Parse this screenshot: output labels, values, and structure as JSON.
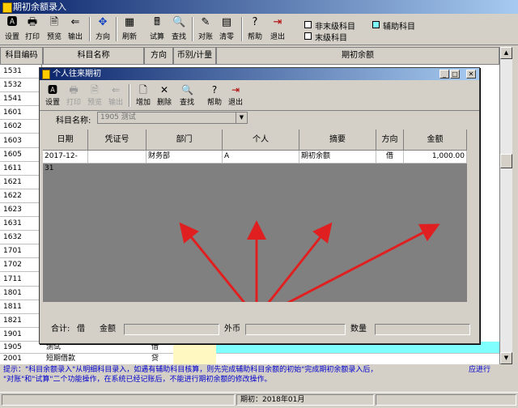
{
  "window": {
    "title": "期初余额录入"
  },
  "toolbar": {
    "buttons": [
      {
        "label": "设置",
        "icon": "settings-icon",
        "glyph": "🅰"
      },
      {
        "label": "打印",
        "icon": "print-icon",
        "glyph": "🖶"
      },
      {
        "label": "预览",
        "icon": "preview-icon",
        "glyph": "🗎"
      },
      {
        "label": "输出",
        "icon": "export-icon",
        "glyph": "⇐"
      },
      {
        "label": "方向",
        "icon": "direction-icon",
        "glyph": "✥"
      },
      {
        "label": "刷新",
        "icon": "refresh-icon",
        "glyph": "▦"
      },
      {
        "label": "试算",
        "icon": "trial-balance-icon",
        "glyph": "🖩"
      },
      {
        "label": "查找",
        "icon": "find-icon",
        "glyph": "🔍"
      },
      {
        "label": "对账",
        "icon": "reconcile-icon",
        "glyph": "✎"
      },
      {
        "label": "清零",
        "icon": "clear-icon",
        "glyph": "▤"
      },
      {
        "label": "帮助",
        "icon": "help-icon",
        "glyph": "?"
      },
      {
        "label": "退出",
        "icon": "exit-icon",
        "glyph": "⇥"
      }
    ],
    "legend": {
      "non_leaf": "非末级科目",
      "aux": "辅助科目",
      "leaf": "末级科目"
    }
  },
  "grid": {
    "headers": [
      "科目编码",
      "科目名称",
      "方向",
      "币别/计量",
      "期初余额"
    ],
    "codes": [
      "1531",
      "1532",
      "1541",
      "1601",
      "1602",
      "1603",
      "1605",
      "1611",
      "1621",
      "1622",
      "1623",
      "1631",
      "1632",
      "1701",
      "1702",
      "1711",
      "1801",
      "1811",
      "1821",
      "1901"
    ],
    "bottom_rows": [
      {
        "code": "1905",
        "name": "测试",
        "dir": "借"
      },
      {
        "code": "2001",
        "name": "短期借款",
        "dir": "贷"
      }
    ]
  },
  "dialog": {
    "title": "个人往来期初",
    "toolbar": [
      {
        "label": "设置",
        "icon": "settings-icon",
        "glyph": "🅰",
        "enabled": true
      },
      {
        "label": "打印",
        "icon": "print-icon",
        "glyph": "🖶",
        "enabled": false
      },
      {
        "label": "预览",
        "icon": "preview-icon",
        "glyph": "🗎",
        "enabled": false
      },
      {
        "label": "输出",
        "icon": "export-icon",
        "glyph": "⇐",
        "enabled": false
      },
      {
        "label": "增加",
        "icon": "add-icon",
        "glyph": "🗋",
        "enabled": true
      },
      {
        "label": "删除",
        "icon": "delete-icon",
        "glyph": "✕",
        "enabled": true
      },
      {
        "label": "查找",
        "icon": "find-icon",
        "glyph": "🔍",
        "enabled": true
      },
      {
        "label": "帮助",
        "icon": "help-icon",
        "glyph": "?",
        "enabled": true
      },
      {
        "label": "退出",
        "icon": "exit-icon",
        "glyph": "⇥",
        "enabled": true
      }
    ],
    "account_label": "科目名称:",
    "account_value": "1905 测试",
    "columns": [
      "日期",
      "凭证号",
      "部门",
      "个人",
      "摘要",
      "方向",
      "金额"
    ],
    "row": {
      "date": "2017-12-31",
      "voucher": "",
      "dept": "财务部",
      "person": "A",
      "summary": "期初余额",
      "dir": "借",
      "amount": "1,000.00"
    },
    "footer": {
      "total_label": "合计:",
      "total_dir": "借",
      "amount_label": "金额",
      "fx_label": "外币",
      "qty_label": "数量"
    }
  },
  "hint": {
    "line1": "提示：\"科目余额录入\"从明细科目录入，如遇有辅助科目核算，则先完成辅助科目余额的初始\"完成期初余额录入后，",
    "line1_right": "应进行",
    "line2": "\"对账\"和\"试算\"二个功能操作，在系统已经记账后，不能进行期初余额的修改操作。"
  },
  "status": {
    "period": "期初：2018年01月"
  },
  "colors": {
    "aux_legend": "#80ffff",
    "annotation_arrow": "#e02020",
    "hint_text": "#0000cc"
  }
}
